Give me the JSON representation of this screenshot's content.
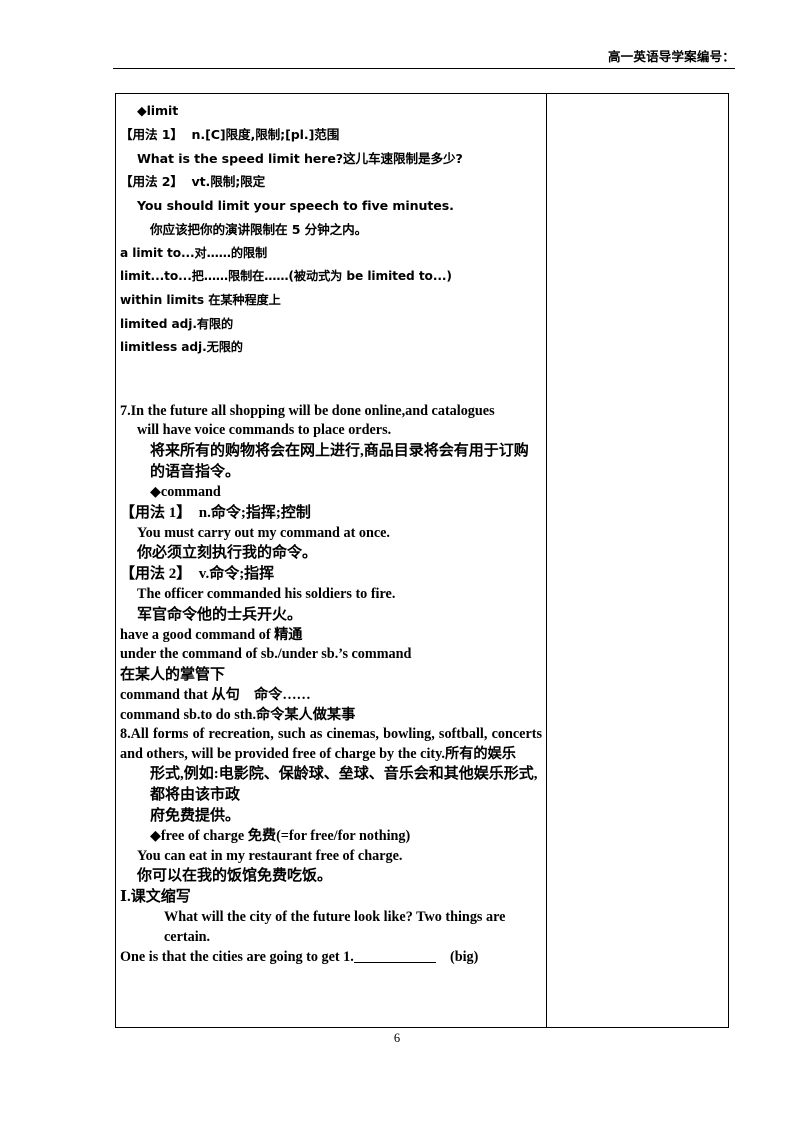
{
  "header": {
    "text": "高一英语导学案编号："
  },
  "page_number": "6",
  "table": {
    "main_column": {
      "limit_entry": {
        "headword": "◆limit",
        "usage1_label": "【用法 1】",
        "usage1_def": "n.[C]限度,限制;[pl.]范围",
        "usage1_example": "What is the speed limit here?这儿车速限制是多少?",
        "usage2_label": "【用法 2】",
        "usage2_def": "vt.限制;限定",
        "usage2_example": "You should limit your speech to five minutes.",
        "usage2_translation": "你应该把你的演讲限制在 5 分钟之内。",
        "phrases": [
          "a limit to...对……的限制",
          "limit...to...把……限制在……(被动式为 be limited to...)",
          "within limits 在某种程度上",
          "limited adj.有限的",
          "limitless adj.无限的"
        ]
      },
      "item7": {
        "sentence": "7.In the future all shopping will be done online,and catalogues",
        "sentence_cont": "will have voice commands to place orders.",
        "translation": "将来所有的购物将会在网上进行,商品目录将会有用于订购的语音指令。"
      },
      "command_entry": {
        "headword": "◆command",
        "usage1_label": "【用法 1】",
        "usage1_def": "n.命令;指挥;控制",
        "usage1_example": "You must carry out my command at once.",
        "usage1_translation": "你必须立刻执行我的命令。",
        "usage2_label": "【用法 2】",
        "usage2_def": "v.命令;指挥",
        "usage2_example": "The officer commanded his soldiers to fire.",
        "usage2_translation": "军官命令他的士兵开火。",
        "phrases": [
          "have a good command of 精通",
          "under the command of sb./under sb.’s command",
          "在某人的掌管下",
          "command that 从句　命令……",
          "command sb.to do sth.命令某人做某事"
        ]
      },
      "item8": {
        "sentence": "8.All forms of recreation, such as cinemas, bowling, softball, concerts and others, will be provided free of charge by the city.所有的娱乐",
        "translation": "形式,例如:电影院、保龄球、垒球、音乐会和其他娱乐形式,都将由该市政",
        "translation_cont": "府免费提供。"
      },
      "free_of_charge_entry": {
        "headword": "◆free of charge 免费(=for free/for nothing)",
        "example": "You can eat in my restaurant free of charge.",
        "translation": "你可以在我的饭馆免费吃饭。"
      },
      "section1": {
        "heading": "Ⅰ.课文缩写",
        "line1": "What will the city of the future look like? Two things are certain.",
        "line2_pre": "One is that the cities are going to get 1.",
        "line2_post": "(big)"
      }
    },
    "side_column": {
      "content": ""
    }
  }
}
